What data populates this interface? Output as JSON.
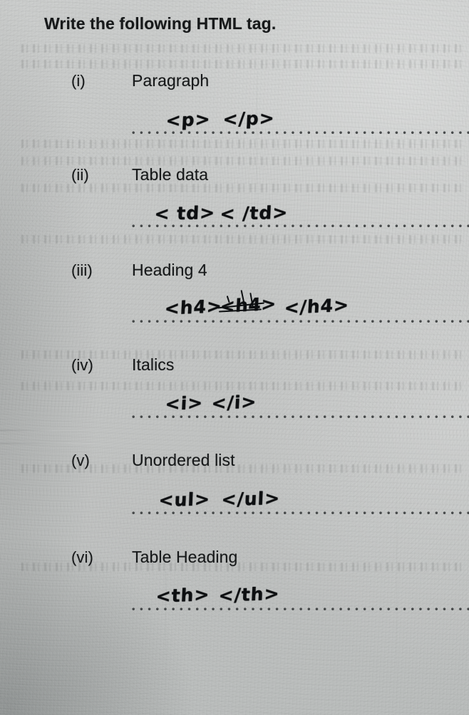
{
  "document": {
    "type": "handwritten-worksheet-scan",
    "prompt": "Write the following HTML tag.",
    "paper_color": "#c3c5c4",
    "ink_color": "#0d0f11",
    "print_color": "#17191a"
  },
  "questions": [
    {
      "numeral": "(i)",
      "label": "Paragraph",
      "answer_open": "<p>",
      "answer_close": "</p>",
      "struck_out": ""
    },
    {
      "numeral": "(ii)",
      "label": "Table data",
      "answer_open": "< td>",
      "answer_close": "< /td>",
      "struck_out": ""
    },
    {
      "numeral": "(iii)",
      "label": "Heading 4",
      "answer_open": "<h4>",
      "answer_close": "</h4>",
      "struck_out": "<h4>"
    },
    {
      "numeral": "(iv)",
      "label": "Italics",
      "answer_open": "<i>",
      "answer_close": "</i>",
      "struck_out": ""
    },
    {
      "numeral": "(v)",
      "label": "Unordered list",
      "answer_open": "<ul>",
      "answer_close": "</ul>",
      "struck_out": ""
    },
    {
      "numeral": "(vi)",
      "label": "Table Heading",
      "answer_open": "<th>",
      "answer_close": "</th>",
      "struck_out": ""
    }
  ]
}
